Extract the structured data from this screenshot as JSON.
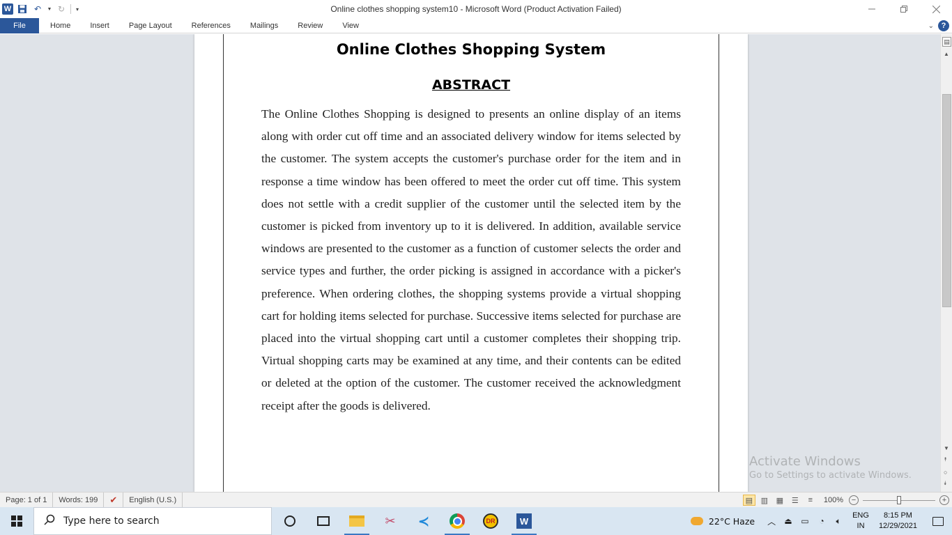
{
  "window": {
    "title": "Online clothes shopping system10  -  Microsoft Word (Product Activation Failed)"
  },
  "ribbon": {
    "tabs": [
      {
        "label": "File"
      },
      {
        "label": "Home"
      },
      {
        "label": "Insert"
      },
      {
        "label": "Page Layout"
      },
      {
        "label": "References"
      },
      {
        "label": "Mailings"
      },
      {
        "label": "Review"
      },
      {
        "label": "View"
      }
    ]
  },
  "document": {
    "title": "Online Clothes Shopping System",
    "heading": "ABSTRACT",
    "body": "The Online Clothes Shopping is designed to presents an online display of an items along with order cut off time and an associated delivery window for items selected by the customer. The system accepts the customer's purchase order for the item and in response a time window has been offered to meet the order cut off time. This system does not settle with a credit supplier of the customer until the selected item by the customer is picked from inventory up to it is delivered. In addition, available service windows are presented to the customer as a function of customer selects the order and service types and further, the order picking is assigned in accordance with a picker's preference. When ordering clothes, the shopping systems provide a virtual shopping cart for holding items selected for purchase. Successive items selected for purchase are placed into the virtual shopping cart until a customer completes their shopping trip. Virtual shopping carts may be examined at any time, and their contents can be edited or deleted at the option of the customer. The customer received the acknowledgment receipt after the goods is delivered."
  },
  "watermark": {
    "line1": "Activate Windows",
    "line2": "Go to Settings to activate Windows."
  },
  "statusbar": {
    "page": "Page: 1 of 1",
    "words": "Words: 199",
    "language": "English (U.S.)",
    "zoom": "100%",
    "zoom_fraction": 0.5
  },
  "taskbar": {
    "search_placeholder": "Type here to search",
    "weather": "22°C  Haze",
    "lang_line1": "ENG",
    "lang_line2": "IN",
    "time": "8:15 PM",
    "date": "12/29/2021"
  },
  "colors": {
    "word_blue": "#2b579a",
    "doc_background": "#dfe3e8",
    "taskbar": "#d9e6f2"
  }
}
